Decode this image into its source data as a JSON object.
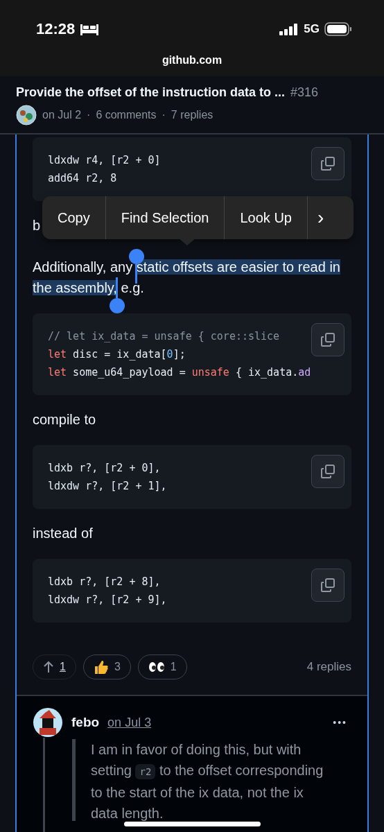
{
  "status_bar": {
    "time": "12:28",
    "network": "5G"
  },
  "browser": {
    "url": "github.com"
  },
  "discussion": {
    "title": "Provide the offset of the instruction data to ...",
    "number": "#316",
    "date": "on Jul 2",
    "separator_1": "·",
    "comments": "6 comments",
    "separator_2": "·",
    "replies": "7 replies"
  },
  "blocks": [
    {
      "kind": "code",
      "lines": [
        [
          {
            "kind": "plain",
            "text": "ldxdw r4, [r2 + 0]"
          }
        ],
        [
          {
            "kind": "plain",
            "text": "add64 r2, 8"
          }
        ]
      ]
    },
    {
      "kind": "text",
      "parts": [
        {
          "text": "b",
          "selected": false
        }
      ]
    },
    {
      "kind": "text",
      "parts": [
        {
          "text": "Additionally, any ",
          "selected": false
        },
        {
          "text": "static offsets are easier to read in the assembly,",
          "selected": true
        },
        {
          "text": " e.g.",
          "selected": false
        }
      ]
    },
    {
      "kind": "code",
      "lines": [
        [
          {
            "kind": "comment",
            "text": "// let ix_data = unsafe { core::slice"
          }
        ],
        [
          {
            "kind": "keyword",
            "text": "let"
          },
          {
            "kind": "plain",
            "text": " disc = ix_data["
          },
          {
            "kind": "number",
            "text": "0"
          },
          {
            "kind": "plain",
            "text": "];"
          }
        ],
        [
          {
            "kind": "keyword",
            "text": "let"
          },
          {
            "kind": "plain",
            "text": " some_u64_payload = "
          },
          {
            "kind": "keyword",
            "text": "unsafe"
          },
          {
            "kind": "plain",
            "text": " { ix_data."
          },
          {
            "kind": "method",
            "text": "ad"
          }
        ]
      ]
    },
    {
      "kind": "text",
      "parts": [
        {
          "text": "compile to",
          "selected": false
        }
      ]
    },
    {
      "kind": "code",
      "lines": [
        [
          {
            "kind": "plain",
            "text": "ldxb r?, [r2 + 0],"
          }
        ],
        [
          {
            "kind": "plain",
            "text": "ldxdw r?, [r2 + 1],"
          }
        ]
      ]
    },
    {
      "kind": "text",
      "parts": [
        {
          "text": "instead of",
          "selected": false
        }
      ]
    },
    {
      "kind": "code",
      "lines": [
        [
          {
            "kind": "plain",
            "text": "ldxb r?, [r2 + 8],"
          }
        ],
        [
          {
            "kind": "plain",
            "text": "ldxdw r?, [r2 + 9],"
          }
        ]
      ]
    }
  ],
  "context_menu": {
    "items": [
      "Copy",
      "Find Selection",
      "Look Up"
    ],
    "more": "›"
  },
  "reactions": [
    {
      "kind": "upvote",
      "count": "1"
    },
    {
      "kind": "thumbs",
      "count": "3"
    },
    {
      "kind": "eyes",
      "count": "1"
    }
  ],
  "replies_link": "4 replies",
  "reply": {
    "author": "febo",
    "date": "on Jul 3",
    "menu": "•••",
    "body": [
      {
        "kind": "text",
        "text": "I am in favor of doing this, but with setting "
      },
      {
        "kind": "code",
        "text": "r2"
      },
      {
        "kind": "text",
        "text": " to the offset corresponding to the start of the ix data, not the ix data length."
      }
    ]
  }
}
